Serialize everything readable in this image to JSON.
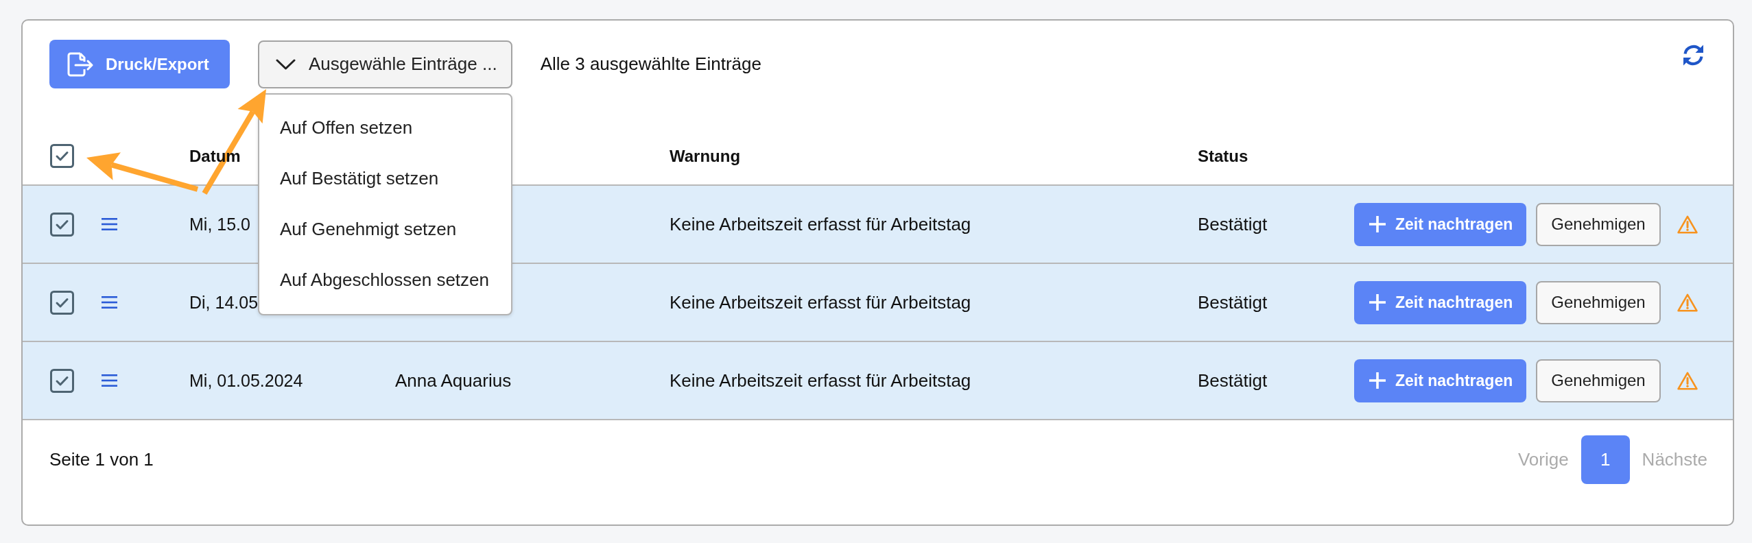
{
  "toolbar": {
    "export_button": {
      "label": "Druck/Export"
    },
    "bulk_dropdown": {
      "label": "Ausgewähle Einträge ...",
      "expanded": true,
      "options": [
        "Auf Offen setzen",
        "Auf Bestätigt setzen",
        "Auf Genehmigt setzen",
        "Auf Abgeschlossen setzen"
      ]
    },
    "selection_info": "Alle 3 ausgewählte Einträge"
  },
  "table": {
    "header": {
      "checked": true,
      "date": "Datum",
      "warning": "Warnung",
      "status": "Status"
    },
    "rows": [
      {
        "checked": true,
        "date": "Mi, 15.0",
        "warning": "Keine Arbeitszeit erfasst für Arbeitstag",
        "status": "Bestätigt",
        "add_time_button": "Zeit nachtragen",
        "approve_button": "Genehmigen"
      },
      {
        "checked": true,
        "date": "Di, 14.05",
        "warning": "Keine Arbeitszeit erfasst für Arbeitstag",
        "status": "Bestätigt",
        "add_time_button": "Zeit nachtragen",
        "approve_button": "Genehmigen"
      },
      {
        "checked": true,
        "date": "Mi, 01.05.2024",
        "name": "Anna Aquarius",
        "warning": "Keine Arbeitszeit erfasst für Arbeitstag",
        "status": "Bestätigt",
        "add_time_button": "Zeit nachtragen",
        "approve_button": "Genehmigen"
      }
    ]
  },
  "pagination": {
    "summary": "Seite 1 von 1",
    "previous": {
      "label": "Vorige",
      "disabled": true
    },
    "pages": [
      {
        "label": "1",
        "selected": true
      }
    ],
    "next": {
      "label": "Nächste",
      "disabled": true
    }
  }
}
